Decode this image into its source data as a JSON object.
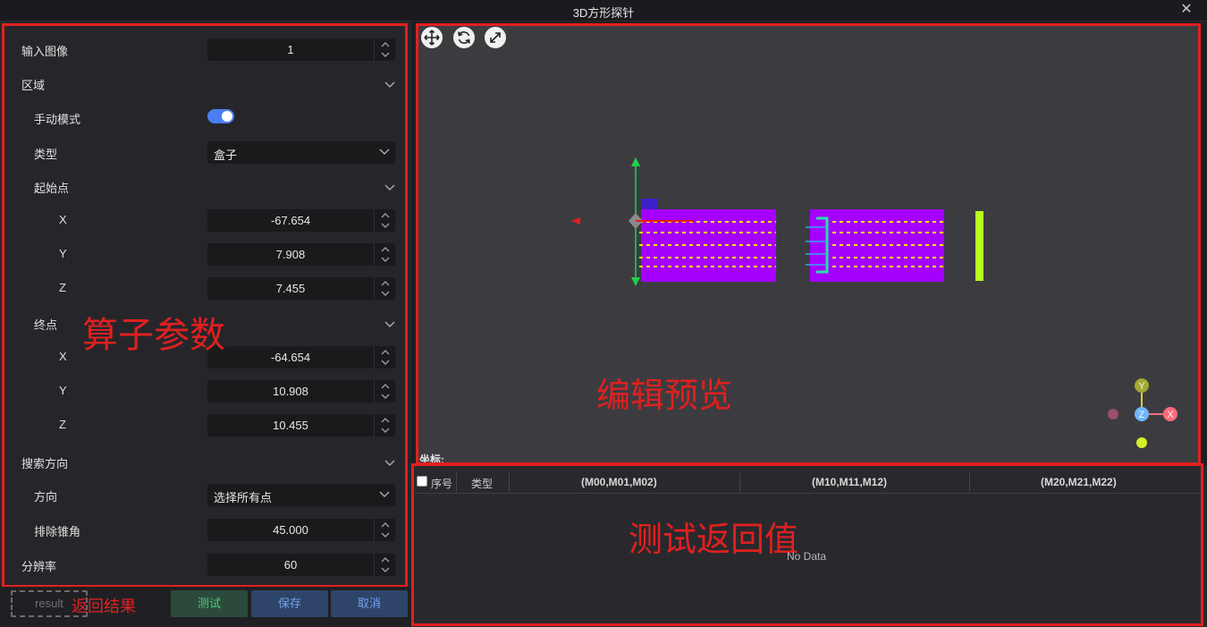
{
  "window": {
    "title": "3D方形探针"
  },
  "params": {
    "input_image": {
      "label": "输入图像",
      "value": "1"
    },
    "region": {
      "label": "区域"
    },
    "manual_mode": {
      "label": "手动模式",
      "on": true
    },
    "type": {
      "label": "类型",
      "value": "盒子"
    },
    "start_point": {
      "label": "起始点",
      "x": {
        "label": "X",
        "value": "-67.654"
      },
      "y": {
        "label": "Y",
        "value": "7.908"
      },
      "z": {
        "label": "Z",
        "value": "7.455"
      }
    },
    "end_point": {
      "label": "终点",
      "x": {
        "label": "X",
        "value": "-64.654"
      },
      "y": {
        "label": "Y",
        "value": "10.908"
      },
      "z": {
        "label": "Z",
        "value": "10.455"
      }
    },
    "search_direction": {
      "label": "搜索方向"
    },
    "direction": {
      "label": "方向",
      "value": "选择所有点"
    },
    "exclude_cone_angle": {
      "label": "排除锥角",
      "value": "45.000"
    },
    "resolution": {
      "label": "分辨率",
      "value": "60"
    }
  },
  "buttons": {
    "result": "result",
    "test": "测试",
    "save": "保存",
    "cancel": "取消"
  },
  "annotations": {
    "operator_params": "算子参数",
    "return_result": "返回结果",
    "edit_preview": "编辑预览",
    "test_return_values": "测试返回值"
  },
  "viewport": {
    "coord_label": "坐标:",
    "axis_labels": {
      "y": "Y",
      "z": "Z",
      "x": "X"
    },
    "tools": [
      "move-icon",
      "rotate-icon",
      "fullscreen-icon"
    ]
  },
  "table": {
    "columns": [
      "序号",
      "类型",
      "(M00,M01,M02)",
      "(M10,M11,M12)",
      "(M20,M21,M22)"
    ],
    "empty_text": "No Data"
  },
  "colors": {
    "annotation": "#e02020",
    "point_cloud": "#a500ff",
    "highlight": "#ffea00",
    "toggle_on": "#4a7ef5"
  }
}
